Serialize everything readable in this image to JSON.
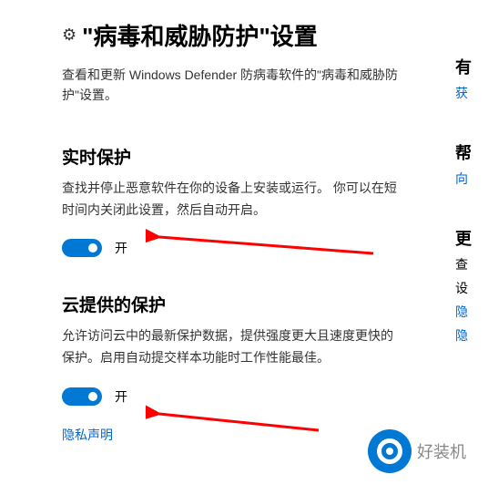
{
  "header": {
    "title": "\"病毒和威胁防护\"设置",
    "subtitle": "查看和更新 Windows Defender 防病毒软件的\"病毒和威胁防护\"设置。"
  },
  "sections": {
    "realtime": {
      "title": "实时保护",
      "desc": "查找并停止恶意软件在你的设备上安装或运行。 你可以在短时间内关闭此设置，然后自动开启。",
      "toggle_state": "on",
      "toggle_label": "开"
    },
    "cloud": {
      "title": "云提供的保护",
      "desc": "允许访问云中的最新保护数据，提供强度更大且速度更快的保护。启用自动提交样本功能时工作性能最佳。",
      "toggle_state": "on",
      "toggle_label": "开",
      "privacy_link": "隐私声明"
    }
  },
  "right_col": {
    "group1": {
      "heading": "有",
      "link": "获"
    },
    "group2": {
      "heading": "帮",
      "link": "向"
    },
    "group3": {
      "heading": "更",
      "text1": "查",
      "text2": "设",
      "link1": "隐",
      "link2": "隐"
    }
  },
  "watermark": {
    "text": "好装机"
  },
  "colors": {
    "accent": "#0078d4",
    "link": "#0066cc"
  }
}
